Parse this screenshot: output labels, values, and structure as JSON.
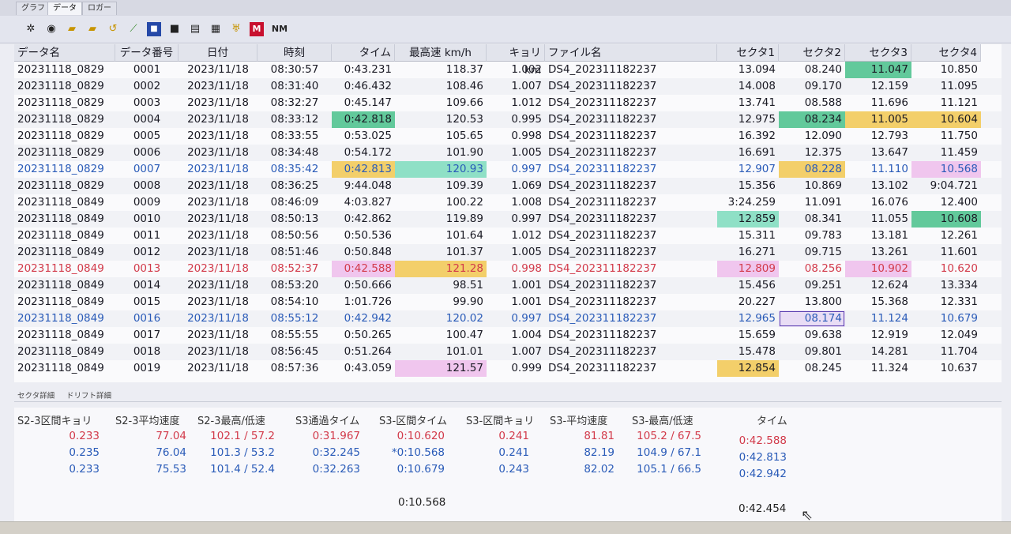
{
  "tabs": [
    "グラフ",
    "データ",
    "ロガー"
  ],
  "active_tab": 1,
  "toolbar": [
    {
      "name": "settings-icon",
      "glyph": "✲",
      "cls": "dark"
    },
    {
      "name": "record-icon",
      "glyph": "◉",
      "cls": "dark"
    },
    {
      "name": "open-folder-icon",
      "glyph": "▰",
      "cls": "yellow"
    },
    {
      "name": "folder-icon",
      "glyph": "▰",
      "cls": "yellow"
    },
    {
      "name": "undo-icon",
      "glyph": "↺",
      "cls": "yellow"
    },
    {
      "name": "chart-icon",
      "glyph": "⟋",
      "cls": "green"
    },
    {
      "name": "save-icon",
      "glyph": "■",
      "cls": "blue"
    },
    {
      "name": "save-as-icon",
      "glyph": "■",
      "cls": "dark"
    },
    {
      "name": "print-icon",
      "glyph": "▤",
      "cls": "dark"
    },
    {
      "name": "calendar-icon",
      "glyph": "▦",
      "cls": "dark"
    },
    {
      "name": "filter-icon",
      "glyph": "♅",
      "cls": "yellow"
    },
    {
      "name": "m-icon",
      "glyph": "M",
      "cls": "red"
    },
    {
      "name": "nm-icon",
      "glyph": "NM",
      "cls": "dark"
    }
  ],
  "columns": [
    "データ名",
    "データ番号",
    "日付",
    "時刻",
    "タイム",
    "最高速 km/h",
    "キョリ km",
    "ファイル名",
    "セクタ1",
    "セクタ2",
    "セクタ3",
    "セクタ4"
  ],
  "rows": [
    {
      "style": "",
      "cells": [
        "20231118_0829",
        "0001",
        "2023/11/18",
        "08:30:57",
        "0:43.231",
        "118.37",
        "1.002",
        "DS4_202311182237",
        "13.094",
        "08.240",
        "11.047",
        "10.850"
      ],
      "hl": {
        "10": "green"
      }
    },
    {
      "style": "",
      "cells": [
        "20231118_0829",
        "0002",
        "2023/11/18",
        "08:31:40",
        "0:46.432",
        "108.46",
        "1.007",
        "DS4_202311182237",
        "14.008",
        "09.170",
        "12.159",
        "11.095"
      ],
      "hl": {}
    },
    {
      "style": "",
      "cells": [
        "20231118_0829",
        "0003",
        "2023/11/18",
        "08:32:27",
        "0:45.147",
        "109.66",
        "1.012",
        "DS4_202311182237",
        "13.741",
        "08.588",
        "11.696",
        "11.121"
      ],
      "hl": {}
    },
    {
      "style": "",
      "cells": [
        "20231118_0829",
        "0004",
        "2023/11/18",
        "08:33:12",
        "0:42.818",
        "120.53",
        "0.995",
        "DS4_202311182237",
        "12.975",
        "08.234",
        "11.005",
        "10.604"
      ],
      "hl": {
        "4": "green",
        "9": "green",
        "10": "yellow",
        "11": "yellow"
      }
    },
    {
      "style": "",
      "cells": [
        "20231118_0829",
        "0005",
        "2023/11/18",
        "08:33:55",
        "0:53.025",
        "105.65",
        "0.998",
        "DS4_202311182237",
        "16.392",
        "12.090",
        "12.793",
        "11.750"
      ],
      "hl": {}
    },
    {
      "style": "",
      "cells": [
        "20231118_0829",
        "0006",
        "2023/11/18",
        "08:34:48",
        "0:54.172",
        "101.90",
        "1.005",
        "DS4_202311182237",
        "16.691",
        "12.375",
        "13.647",
        "11.459"
      ],
      "hl": {}
    },
    {
      "style": "blue",
      "cells": [
        "20231118_0829",
        "0007",
        "2023/11/18",
        "08:35:42",
        "0:42.813",
        "120.93",
        "0.997",
        "DS4_202311182237",
        "12.907",
        "08.228",
        "11.110",
        "10.568"
      ],
      "hl": {
        "4": "yellow",
        "5": "teal",
        "9": "yellow",
        "11": "pink"
      }
    },
    {
      "style": "",
      "cells": [
        "20231118_0829",
        "0008",
        "2023/11/18",
        "08:36:25",
        "9:44.048",
        "109.39",
        "1.069",
        "DS4_202311182237",
        "15.356",
        "10.869",
        "13.102",
        "9:04.721"
      ],
      "hl": {}
    },
    {
      "style": "",
      "cells": [
        "20231118_0849",
        "0009",
        "2023/11/18",
        "08:46:09",
        "4:03.827",
        "100.22",
        "1.008",
        "DS4_202311182237",
        "3:24.259",
        "11.091",
        "16.076",
        "12.400"
      ],
      "hl": {}
    },
    {
      "style": "",
      "cells": [
        "20231118_0849",
        "0010",
        "2023/11/18",
        "08:50:13",
        "0:42.862",
        "119.89",
        "0.997",
        "DS4_202311182237",
        "12.859",
        "08.341",
        "11.055",
        "10.608"
      ],
      "hl": {
        "8": "teal",
        "11": "green"
      }
    },
    {
      "style": "",
      "cells": [
        "20231118_0849",
        "0011",
        "2023/11/18",
        "08:50:56",
        "0:50.536",
        "101.64",
        "1.012",
        "DS4_202311182237",
        "15.311",
        "09.783",
        "13.181",
        "12.261"
      ],
      "hl": {}
    },
    {
      "style": "",
      "cells": [
        "20231118_0849",
        "0012",
        "2023/11/18",
        "08:51:46",
        "0:50.848",
        "101.37",
        "1.005",
        "DS4_202311182237",
        "16.271",
        "09.715",
        "13.261",
        "11.601"
      ],
      "hl": {}
    },
    {
      "style": "red",
      "cells": [
        "20231118_0849",
        "0013",
        "2023/11/18",
        "08:52:37",
        "0:42.588",
        "121.28",
        "0.998",
        "DS4_202311182237",
        "12.809",
        "08.256",
        "10.902",
        "10.620"
      ],
      "hl": {
        "4": "pink",
        "5": "yellow",
        "8": "pink",
        "10": "pink"
      }
    },
    {
      "style": "",
      "cells": [
        "20231118_0849",
        "0014",
        "2023/11/18",
        "08:53:20",
        "0:50.666",
        "98.51",
        "1.001",
        "DS4_202311182237",
        "15.456",
        "09.251",
        "12.624",
        "13.334"
      ],
      "hl": {}
    },
    {
      "style": "",
      "cells": [
        "20231118_0849",
        "0015",
        "2023/11/18",
        "08:54:10",
        "1:01.726",
        "99.90",
        "1.001",
        "DS4_202311182237",
        "20.227",
        "13.800",
        "15.368",
        "12.331"
      ],
      "hl": {}
    },
    {
      "style": "blue",
      "cells": [
        "20231118_0849",
        "0016",
        "2023/11/18",
        "08:55:12",
        "0:42.942",
        "120.02",
        "0.997",
        "DS4_202311182237",
        "12.965",
        "08.174",
        "11.124",
        "10.679"
      ],
      "hl": {
        "9": "outline"
      }
    },
    {
      "style": "",
      "cells": [
        "20231118_0849",
        "0017",
        "2023/11/18",
        "08:55:55",
        "0:50.265",
        "100.47",
        "1.004",
        "DS4_202311182237",
        "15.659",
        "09.638",
        "12.919",
        "12.049"
      ],
      "hl": {}
    },
    {
      "style": "",
      "cells": [
        "20231118_0849",
        "0018",
        "2023/11/18",
        "08:56:45",
        "0:51.264",
        "101.01",
        "1.007",
        "DS4_202311182237",
        "15.478",
        "09.801",
        "14.281",
        "11.704"
      ],
      "hl": {}
    },
    {
      "style": "",
      "cells": [
        "20231118_0849",
        "0019",
        "2023/11/18",
        "08:57:36",
        "0:43.059",
        "121.57",
        "0.999",
        "DS4_202311182237",
        "12.854",
        "08.245",
        "11.324",
        "10.637"
      ],
      "hl": {
        "5": "pink",
        "8": "yellow"
      }
    }
  ],
  "lower_tabs": [
    "セクタ詳細",
    "ドリフト詳細"
  ],
  "lower_columns": [
    "S2-3区間キョリ",
    "S2-3平均速度",
    "S2-3最高/低速",
    "S3通過タイム",
    "S3-区間タイム",
    "S3-区間キョリ",
    "S3-平均速度",
    "S3-最高/低速",
    "タイム"
  ],
  "lower_rows": [
    {
      "style": "red",
      "cells": [
        "0.233",
        "77.04",
        "102.1 / 57.2",
        "0:31.967",
        "0:10.620",
        "0.241",
        "81.81",
        "105.2 / 67.5",
        "0:42.588"
      ]
    },
    {
      "style": "blue",
      "cells": [
        "0.235",
        "76.04",
        "101.3 / 53.2",
        "0:32.245",
        "*0:10.568",
        "0.241",
        "82.19",
        "104.9 / 67.1",
        "0:42.813"
      ]
    },
    {
      "style": "blue",
      "cells": [
        "0.233",
        "75.53",
        "101.4 / 52.4",
        "0:32.263",
        "0:10.679",
        "0.243",
        "82.02",
        "105.1 / 66.5",
        "0:42.942"
      ]
    }
  ],
  "lower_totals": {
    "s3_section_time": "0:10.568",
    "time": "0:42.454"
  },
  "colors": {
    "green": "#62c99b",
    "yellow": "#f3cf6a",
    "pink": "#f0c6ee",
    "teal": "#8fe0c6",
    "blue_text": "#2a5bb8",
    "red_text": "#d23a4a"
  }
}
